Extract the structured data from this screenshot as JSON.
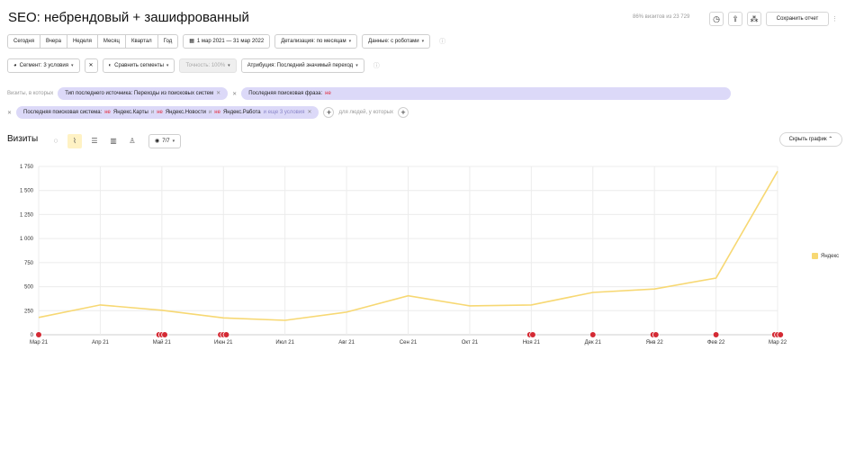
{
  "header": {
    "title": "SEO: небрендовый + зашифрованный",
    "meta": "86% визитов из 23 729",
    "save_label": "Сохранить отчет"
  },
  "period": {
    "buttons": [
      "Сегодня",
      "Вчера",
      "Неделя",
      "Месяц",
      "Квартал",
      "Год"
    ],
    "range_label": "1 мар 2021 — 31 мар 2022",
    "detail_label": "Детализация: по месяцам",
    "data_label": "Данные: с роботами"
  },
  "segment": {
    "segment_label": "Сегмент: 3 условия",
    "compare_label": "Сравнить сегменты",
    "accuracy_label": "Точность: 100%",
    "attribution_label": "Атрибуция: Последний значимый переход"
  },
  "filters": {
    "visits_label": "Визиты, в которых",
    "chip1": "Тип последнего источника: Переходы из поисковых систем",
    "chip2_prefix": "Последняя поисковая фраза:",
    "chip2_not": "не",
    "chip3_prefix": "Последняя поисковая система:",
    "chip3_not1": "не",
    "chip3_v1": "Яндекс.Карты",
    "chip3_sep1": "и",
    "chip3_not2": "не",
    "chip3_v2": "Яндекс.Новости",
    "chip3_sep2": "и",
    "chip3_not3": "не",
    "chip3_v3": "Яндекс.Работа",
    "chip3_more": "и еще 3 условия",
    "people_label": "для людей, у которых"
  },
  "chart_header": {
    "title": "Визиты",
    "series_count": "7/7",
    "hide_label": "Скрыть график"
  },
  "chart_data": {
    "type": "line",
    "categories": [
      "Мар 21",
      "Апр 21",
      "Май 21",
      "Июн 21",
      "Июл 21",
      "Авг 21",
      "Сен 21",
      "Окт 21",
      "Ноя 21",
      "Дек 21",
      "Янв 22",
      "Фев 22",
      "Мар 22"
    ],
    "series": [
      {
        "name": "Яндекс",
        "color": "#f7d873",
        "values": [
          180,
          310,
          255,
          175,
          150,
          235,
          405,
          300,
          310,
          440,
          475,
          590,
          1700
        ]
      }
    ],
    "ylim": [
      0,
      1750
    ],
    "yticks": [
      0,
      250,
      500,
      750,
      1000,
      1250,
      1500,
      1750
    ],
    "ytick_labels": [
      "0",
      "250",
      "500",
      "750",
      "1 000",
      "1 250",
      "1 500",
      "1 750"
    ],
    "grid": true,
    "legend": "right",
    "annotation_markers": [
      {
        "category": "Мар 21",
        "count": 1
      },
      {
        "category": "Май 21",
        "count": 3
      },
      {
        "category": "Июн 21",
        "count": 3
      },
      {
        "category": "Ноя 21",
        "count": 2
      },
      {
        "category": "Дек 21",
        "count": 1
      },
      {
        "category": "Янв 22",
        "count": 2
      },
      {
        "category": "Фев 22",
        "count": 1
      },
      {
        "category": "Мар 22",
        "count": 3
      }
    ]
  }
}
